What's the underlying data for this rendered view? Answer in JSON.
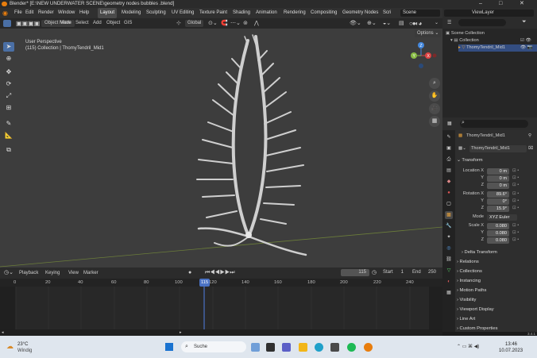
{
  "window": {
    "title": "Blender* [E:\\NEW UNDERWATER SCENE\\geometry nodes bubbles .blend]",
    "min": "–",
    "max": "□",
    "close": "✕"
  },
  "menu": {
    "items": [
      "File",
      "Edit",
      "Render",
      "Window",
      "Help"
    ]
  },
  "workspaces": {
    "tabs": [
      "Layout",
      "Modeling",
      "Sculpting",
      "UV Editing",
      "Texture Paint",
      "Shading",
      "Animation",
      "Rendering",
      "Compositing",
      "Geometry Nodes",
      "Scri"
    ],
    "active": "Layout"
  },
  "scene": {
    "label": "Scene",
    "viewlayer": "ViewLayer"
  },
  "viewport": {
    "mode": "Object Mode",
    "menus": [
      "View",
      "Select",
      "Add",
      "Object",
      "GIS"
    ],
    "transform_orientation": "Global",
    "options": "Options",
    "info_line1": "User Perspective",
    "info_line2": "(115) Collection | ThomyTendril_Mid1",
    "gizmo": {
      "x": "X",
      "y": "Y",
      "z": "Z"
    }
  },
  "outliner": {
    "root": "Scene Collection",
    "collection": "Collection",
    "object": "ThomyTendril_Mid1"
  },
  "properties": {
    "search_placeholder": "",
    "object_name": "ThomyTendril_Mid1",
    "data_name": "ThomyTendril_Mid1",
    "transform_label": "Transform",
    "location": {
      "label": "Location X",
      "x": "0 m",
      "y": "0 m",
      "z": "0 m"
    },
    "rotation": {
      "label": "Rotation X",
      "x": "89.6°",
      "y": "0°",
      "z": "15.9°"
    },
    "mode": {
      "label": "Mode",
      "value": "XYZ Euler"
    },
    "scale": {
      "label": "Scale X",
      "x": "0.080",
      "y": "0.080",
      "z": "0.080"
    },
    "axis_y": "Y",
    "axis_z": "Z",
    "panels": [
      "Delta Transform",
      "Relations",
      "Collections",
      "Instancing",
      "Motion Paths",
      "Visibility",
      "Viewport Display",
      "Line Art",
      "Custom Properties"
    ]
  },
  "timeline": {
    "menus": [
      "Playback",
      "Keying",
      "View",
      "Marker"
    ],
    "current_frame": "115",
    "start_label": "Start",
    "start": "1",
    "end_label": "End",
    "end": "250",
    "ruler": [
      "0",
      "20",
      "40",
      "60",
      "80",
      "100",
      "120",
      "140",
      "160",
      "180",
      "200",
      "220",
      "240"
    ],
    "playhead": "115"
  },
  "version": "3.4.1",
  "taskbar": {
    "weather_temp": "23°C",
    "weather_desc": "Windig",
    "search": "Suche",
    "time": "13:46",
    "date": "10.07.2023"
  }
}
